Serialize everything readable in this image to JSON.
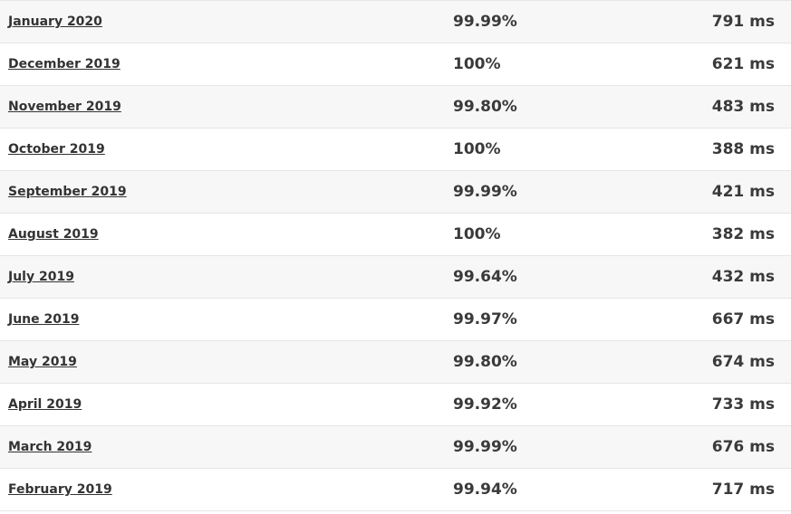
{
  "rows": [
    {
      "month": "January 2020",
      "uptime": "99.99%",
      "response": "791 ms"
    },
    {
      "month": "December 2019",
      "uptime": "100%",
      "response": "621 ms"
    },
    {
      "month": "November 2019",
      "uptime": "99.80%",
      "response": "483 ms"
    },
    {
      "month": "October 2019",
      "uptime": "100%",
      "response": "388 ms"
    },
    {
      "month": "September 2019",
      "uptime": "99.99%",
      "response": "421 ms"
    },
    {
      "month": "August 2019",
      "uptime": "100%",
      "response": "382 ms"
    },
    {
      "month": "July 2019",
      "uptime": "99.64%",
      "response": "432 ms"
    },
    {
      "month": "June 2019",
      "uptime": "99.97%",
      "response": "667 ms"
    },
    {
      "month": "May 2019",
      "uptime": "99.80%",
      "response": "674 ms"
    },
    {
      "month": "April 2019",
      "uptime": "99.92%",
      "response": "733 ms"
    },
    {
      "month": "March 2019",
      "uptime": "99.99%",
      "response": "676 ms"
    },
    {
      "month": "February 2019",
      "uptime": "99.94%",
      "response": "717 ms"
    }
  ]
}
